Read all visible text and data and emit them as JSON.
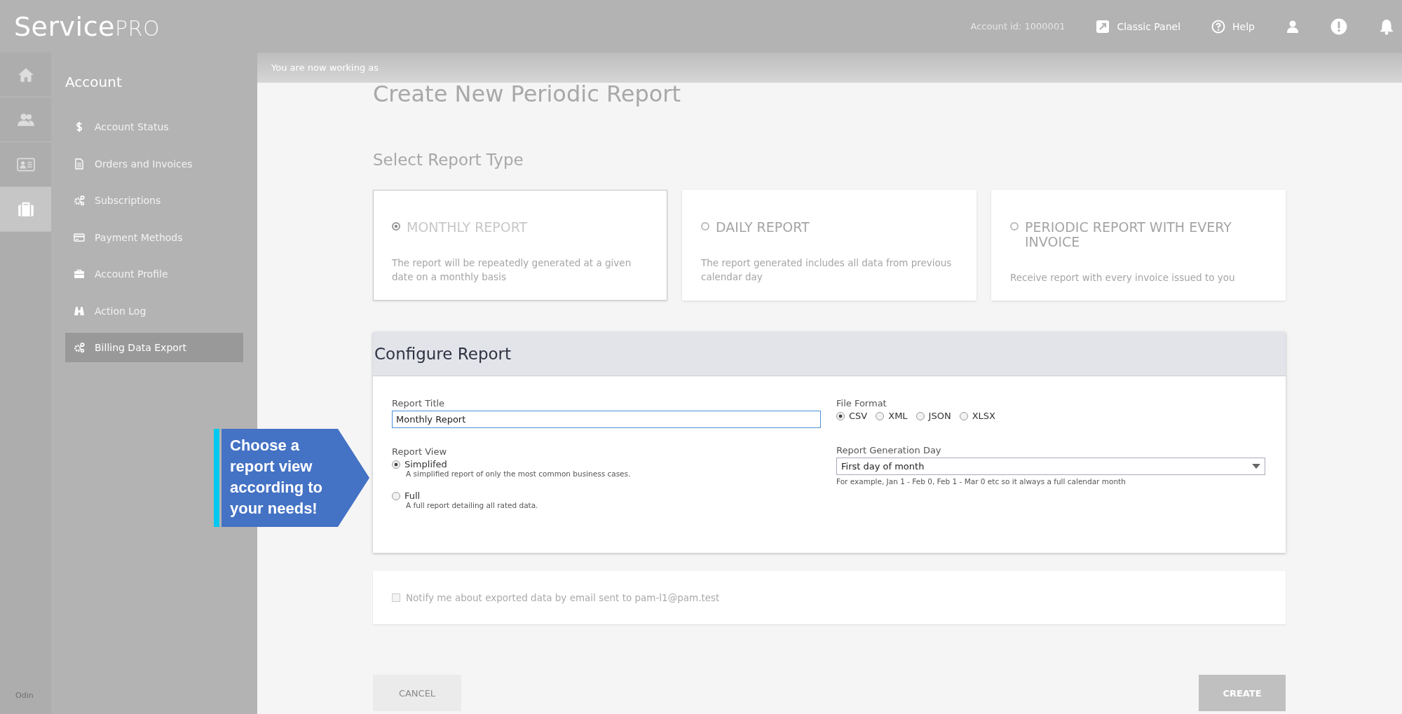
{
  "header": {
    "logo_main": "Service",
    "logo_suffix": "PRO",
    "account_id": "Account id: 1000001",
    "links": [
      {
        "kind": "external",
        "label": "Classic Panel"
      },
      {
        "kind": "help",
        "label": "Help"
      }
    ]
  },
  "rail": [
    {
      "kind": "home",
      "selected": false
    },
    {
      "kind": "users",
      "selected": false
    },
    {
      "kind": "idcard",
      "selected": false
    },
    {
      "kind": "briefcase",
      "selected": true
    }
  ],
  "rail_footer": "Odin",
  "sidebar": {
    "title": "Account",
    "items": [
      {
        "kind": "dollar",
        "label": "Account Status",
        "selected": false
      },
      {
        "kind": "document",
        "label": "Orders and Invoices",
        "selected": false
      },
      {
        "kind": "gears",
        "label": "Subscriptions",
        "selected": false
      },
      {
        "kind": "card",
        "label": "Payment Methods",
        "selected": false
      },
      {
        "kind": "briefcase",
        "label": "Account Profile",
        "selected": false
      },
      {
        "kind": "binoculars",
        "label": "Action Log",
        "selected": false
      },
      {
        "kind": "gears",
        "label": "Billing Data Export",
        "selected": true
      }
    ]
  },
  "banner": "You are now working as",
  "page_title": "Create New Periodic Report",
  "report_type": {
    "heading": "Select Report Type",
    "options": [
      {
        "title": "MONTHLY REPORT",
        "description": "The report will be repeatedly generated at a given date on a monthly basis",
        "selected": true
      },
      {
        "title": "DAILY REPORT",
        "description": "The report generated includes all data from previous calendar day",
        "selected": false
      },
      {
        "title": "PERIODIC REPORT WITH EVERY INVOICE",
        "description": "Receive report with every invoice issued to you",
        "selected": false
      }
    ]
  },
  "configure": {
    "heading": "Configure Report",
    "report_title": {
      "label": "Report Title",
      "value": "Monthly Report"
    },
    "report_view": {
      "label": "Report View",
      "options": [
        {
          "label": "Simplifed",
          "hint": "A simplified report of only the most common business cases.",
          "selected": true
        },
        {
          "label": "Full",
          "hint": "A full report detailing all rated data.",
          "selected": false
        }
      ]
    },
    "file_format": {
      "label": "File Format",
      "options": [
        {
          "label": "CSV",
          "selected": true
        },
        {
          "label": "XML",
          "selected": false
        },
        {
          "label": "JSON",
          "selected": false
        },
        {
          "label": "XLSX",
          "selected": false
        }
      ]
    },
    "generation_day": {
      "label": "Report Generation Day",
      "value": "First day of month",
      "hint": "For example, Jan 1 - Feb 0, Feb 1 - Mar 0 etc so it always a full calendar month"
    }
  },
  "notify": {
    "label": "Notify me about exported data by email sent to pam-l1@pam.test",
    "checked": false
  },
  "buttons": {
    "cancel": "CANCEL",
    "create": "CREATE"
  },
  "callout": "Choose a report view according to your needs!"
}
